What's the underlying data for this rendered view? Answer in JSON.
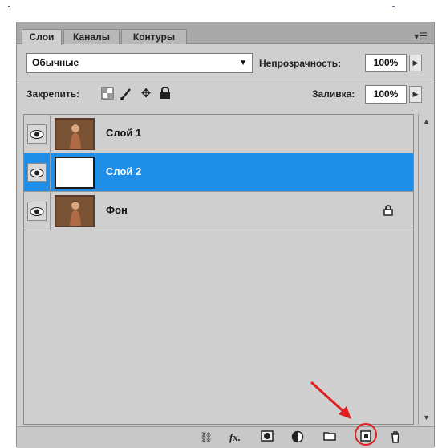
{
  "tabs": [
    {
      "label": "Слои",
      "active": true
    },
    {
      "label": "Каналы",
      "active": false
    },
    {
      "label": "Контуры",
      "active": false
    }
  ],
  "panel_menu_icon": "panel-menu-icon",
  "blend_mode": {
    "value": "Обычные"
  },
  "opacity": {
    "label": "Непрозрачность:",
    "value": "100%"
  },
  "lock": {
    "label": "Закрепить:",
    "icons": [
      "lock-transparent-icon",
      "lock-paint-icon",
      "lock-move-icon",
      "lock-all-icon"
    ]
  },
  "fill": {
    "label": "Заливка:",
    "value": "100%"
  },
  "layers": [
    {
      "name": "Слой 1",
      "visible": true,
      "selected": false,
      "thumb": "photo",
      "locked": false
    },
    {
      "name": "Слой 2",
      "visible": true,
      "selected": true,
      "thumb": "white",
      "locked": false
    },
    {
      "name": "Фон",
      "visible": true,
      "selected": false,
      "thumb": "photo",
      "locked": true
    }
  ],
  "bottom_icons": [
    "link-layers-icon",
    "fx-icon",
    "add-mask-icon",
    "adjustment-layer-icon",
    "new-group-icon",
    "new-layer-icon",
    "trash-icon"
  ],
  "fx_label": "fx.",
  "colors": {
    "selection": "#1f8ee8",
    "panel": "#cfcfcf",
    "highlight": "#e02020"
  }
}
